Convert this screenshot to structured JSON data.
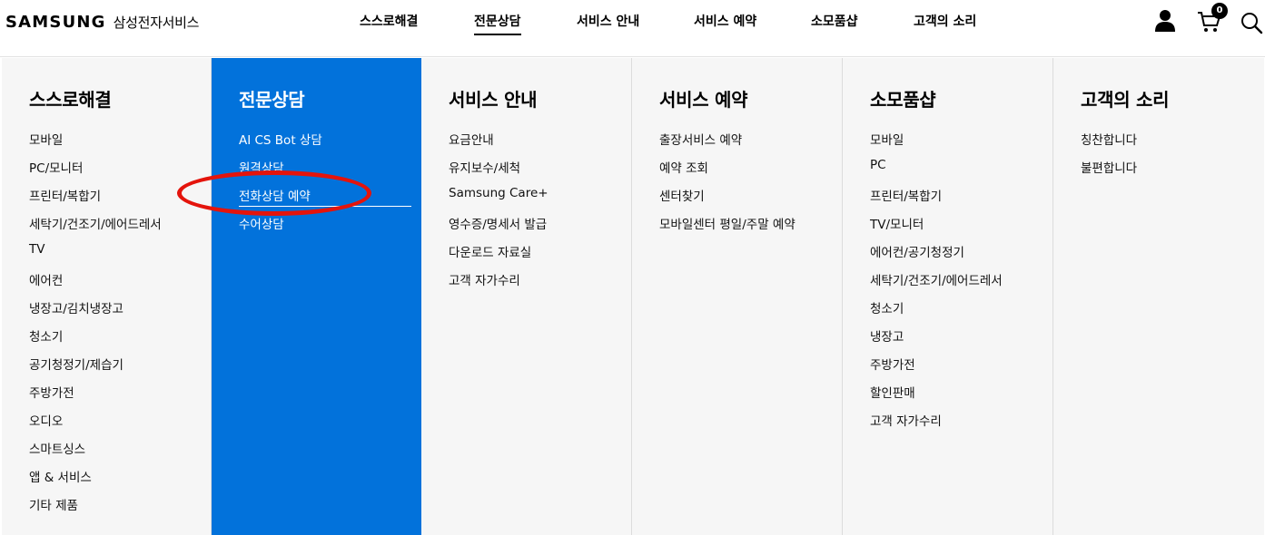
{
  "header": {
    "logo_word": "SAMSUNG",
    "logo_sub": "삼성전자서비스",
    "nav": [
      {
        "label": "스스로해결"
      },
      {
        "label": "전문상담"
      },
      {
        "label": "서비스 안내"
      },
      {
        "label": "서비스 예약"
      },
      {
        "label": "소모품샵"
      },
      {
        "label": "고객의 소리"
      }
    ],
    "active_nav": "전문상담",
    "icons": [
      "user-icon",
      "cart-icon",
      "search-icon"
    ],
    "cart_count": "0"
  },
  "menu": {
    "columns": [
      {
        "title": "스스로해결",
        "items": [
          "모바일",
          "PC/모니터",
          "프린터/복합기",
          "세탁기/건조기/에어드레서",
          "TV",
          "에어컨",
          "냉장고/김치냉장고",
          "청소기",
          "공기청정기/제습기",
          "주방가전",
          "오디오",
          "스마트싱스",
          "앱 & 서비스",
          "기타 제품"
        ]
      },
      {
        "title": "전문상담",
        "items": [
          "AI CS Bot 상담",
          "원격상담",
          "전화상담 예약",
          "수어상담"
        ],
        "current_item": "전화상담 예약"
      },
      {
        "title": "서비스 안내",
        "items": [
          "요금안내",
          "유지보수/세척",
          "Samsung Care+",
          "영수증/명세서 발급",
          "다운로드 자료실",
          "고객 자가수리"
        ]
      },
      {
        "title": "서비스 예약",
        "items": [
          "출장서비스 예약",
          "예약 조회",
          "센터찾기",
          "모바일센터 평일/주말 예약"
        ]
      },
      {
        "title": "소모품샵",
        "items": [
          "모바일",
          "PC",
          "프린터/복합기",
          "TV/모니터",
          "에어컨/공기청정기",
          "세탁기/건조기/에어드레서",
          "청소기",
          "냉장고",
          "주방가전",
          "할인판매",
          "고객 자가수리"
        ]
      },
      {
        "title": "고객의 소리",
        "items": [
          "칭찬합니다",
          "불편합니다"
        ]
      }
    ]
  },
  "colors": {
    "active_column_bg": "#0272db",
    "menu_bg": "#f6f6f6",
    "annotation_ring": "#e4140c"
  }
}
